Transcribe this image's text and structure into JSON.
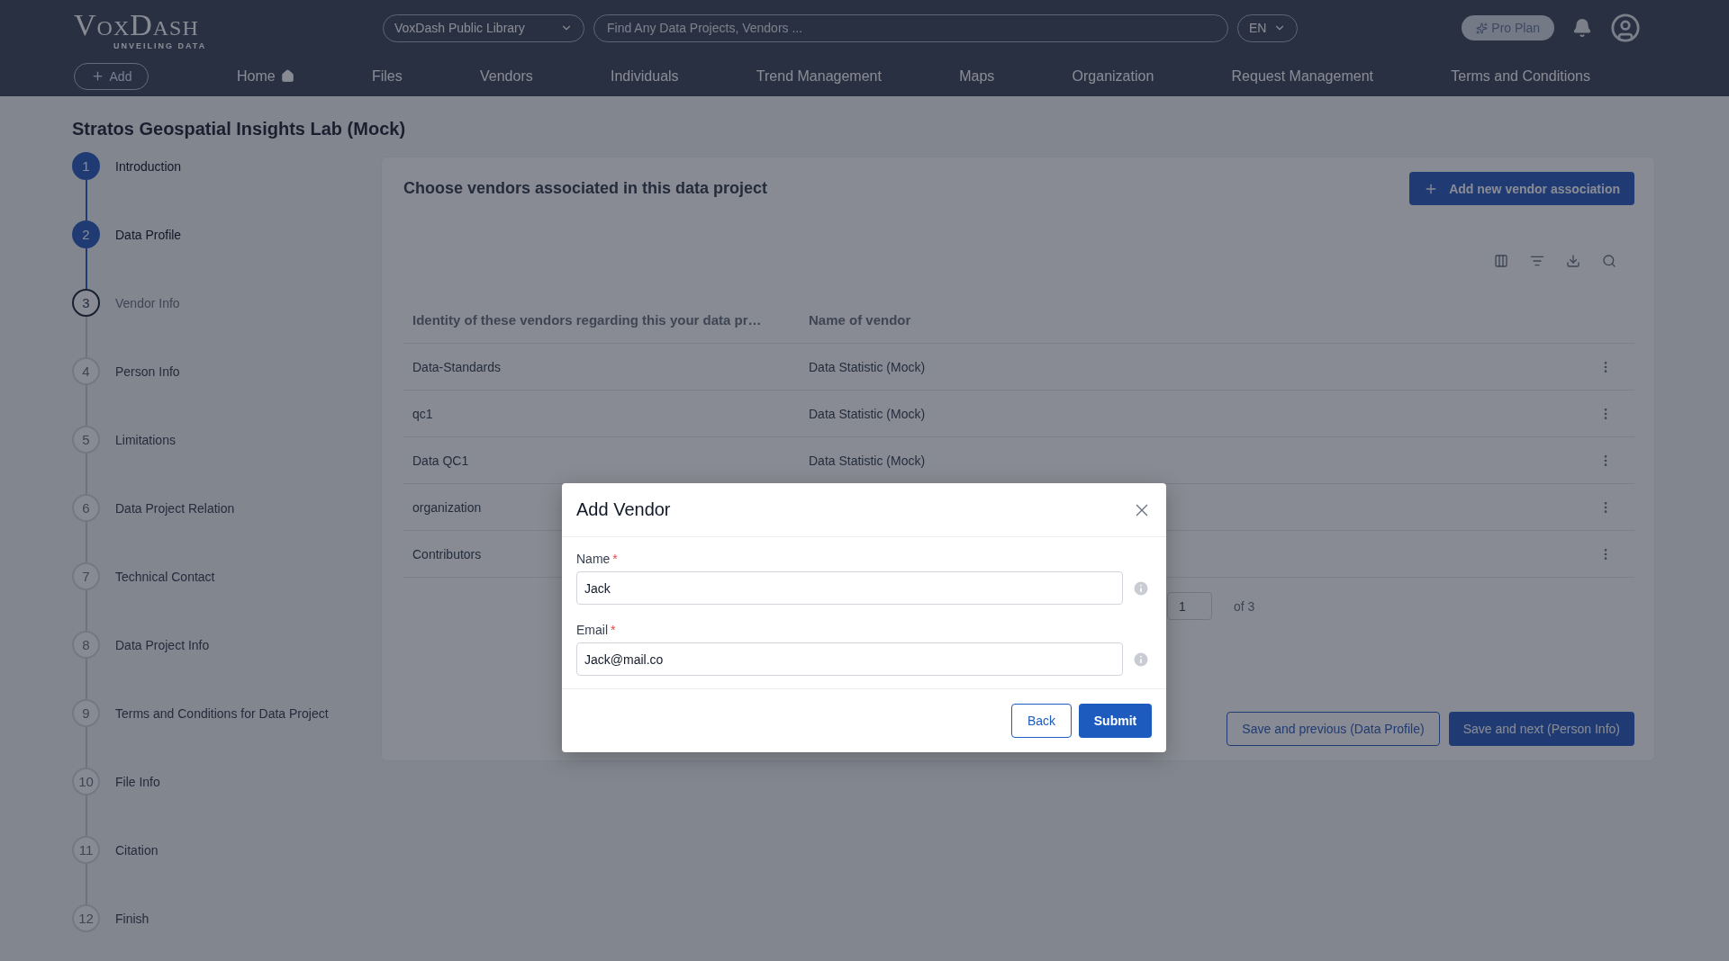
{
  "header": {
    "logo": "VoxDash",
    "logo_tagline": "UNVEILING DATA",
    "library_select": "VoxDash Public Library",
    "search": {
      "placeholder": "Find Any Data Projects, Vendors ..."
    },
    "language": "EN",
    "plan_badge": "Pro Plan"
  },
  "nav": {
    "add_button": "Add",
    "items": [
      {
        "label": "Home",
        "kind": "home"
      },
      {
        "label": "Files",
        "kind": "text"
      },
      {
        "label": "Vendors",
        "kind": "text"
      },
      {
        "label": "Individuals",
        "kind": "text"
      },
      {
        "label": "Trend Management",
        "kind": "text"
      },
      {
        "label": "Maps",
        "kind": "text"
      },
      {
        "label": "Organization",
        "kind": "text"
      },
      {
        "label": "Request Management",
        "kind": "text"
      },
      {
        "label": "Terms and Conditions",
        "kind": "text"
      }
    ]
  },
  "page_title": "Stratos Geospatial Insights Lab (Mock)",
  "steps": [
    {
      "number": "1",
      "label": "Introduction",
      "completed": true,
      "selected": false
    },
    {
      "number": "2",
      "label": "Data Profile",
      "completed": true,
      "selected": false
    },
    {
      "number": "3",
      "label": "Vendor Info",
      "completed": false,
      "selected": true
    },
    {
      "number": "4",
      "label": "Person Info",
      "completed": false,
      "selected": false
    },
    {
      "number": "5",
      "label": "Limitations",
      "completed": false,
      "selected": false
    },
    {
      "number": "6",
      "label": "Data Project Relation",
      "completed": false,
      "selected": false
    },
    {
      "number": "7",
      "label": "Technical Contact",
      "completed": false,
      "selected": false
    },
    {
      "number": "8",
      "label": "Data Project Info",
      "completed": false,
      "selected": false
    },
    {
      "number": "9",
      "label": "Terms and Conditions for Data Project",
      "completed": false,
      "selected": false
    },
    {
      "number": "10",
      "label": "File Info",
      "completed": false,
      "selected": false
    },
    {
      "number": "11",
      "label": "Citation",
      "completed": false,
      "selected": false
    },
    {
      "number": "12",
      "label": "Finish",
      "completed": false,
      "selected": false
    }
  ],
  "main": {
    "heading": "Choose vendors associated in this data project",
    "add_button": "Add new vendor association",
    "table": {
      "columns": [
        "Identity of these vendors regarding this your data pr…",
        "Name of vendor"
      ],
      "rows": [
        [
          "Data-Standards",
          "Data Statistic (Mock)"
        ],
        [
          "qc1",
          "Data Statistic (Mock)"
        ],
        [
          "Data QC1",
          "Data Statistic (Mock)"
        ],
        [
          "organization"
        ],
        [
          "Contributors"
        ]
      ]
    },
    "pagination": {
      "page": "1",
      "of": "of 3"
    },
    "previous_button": "Save and previous (Data Profile)",
    "next_button": "Save and next (Person Info)"
  },
  "modal": {
    "title": "Add Vendor",
    "fields": [
      {
        "label": "Name",
        "required_mark": "*",
        "value": "Jack"
      },
      {
        "label": "Email",
        "required_mark": "*",
        "value": "Jack@mail.co"
      }
    ],
    "back_button": "Back",
    "submit_button": "Submit"
  }
}
